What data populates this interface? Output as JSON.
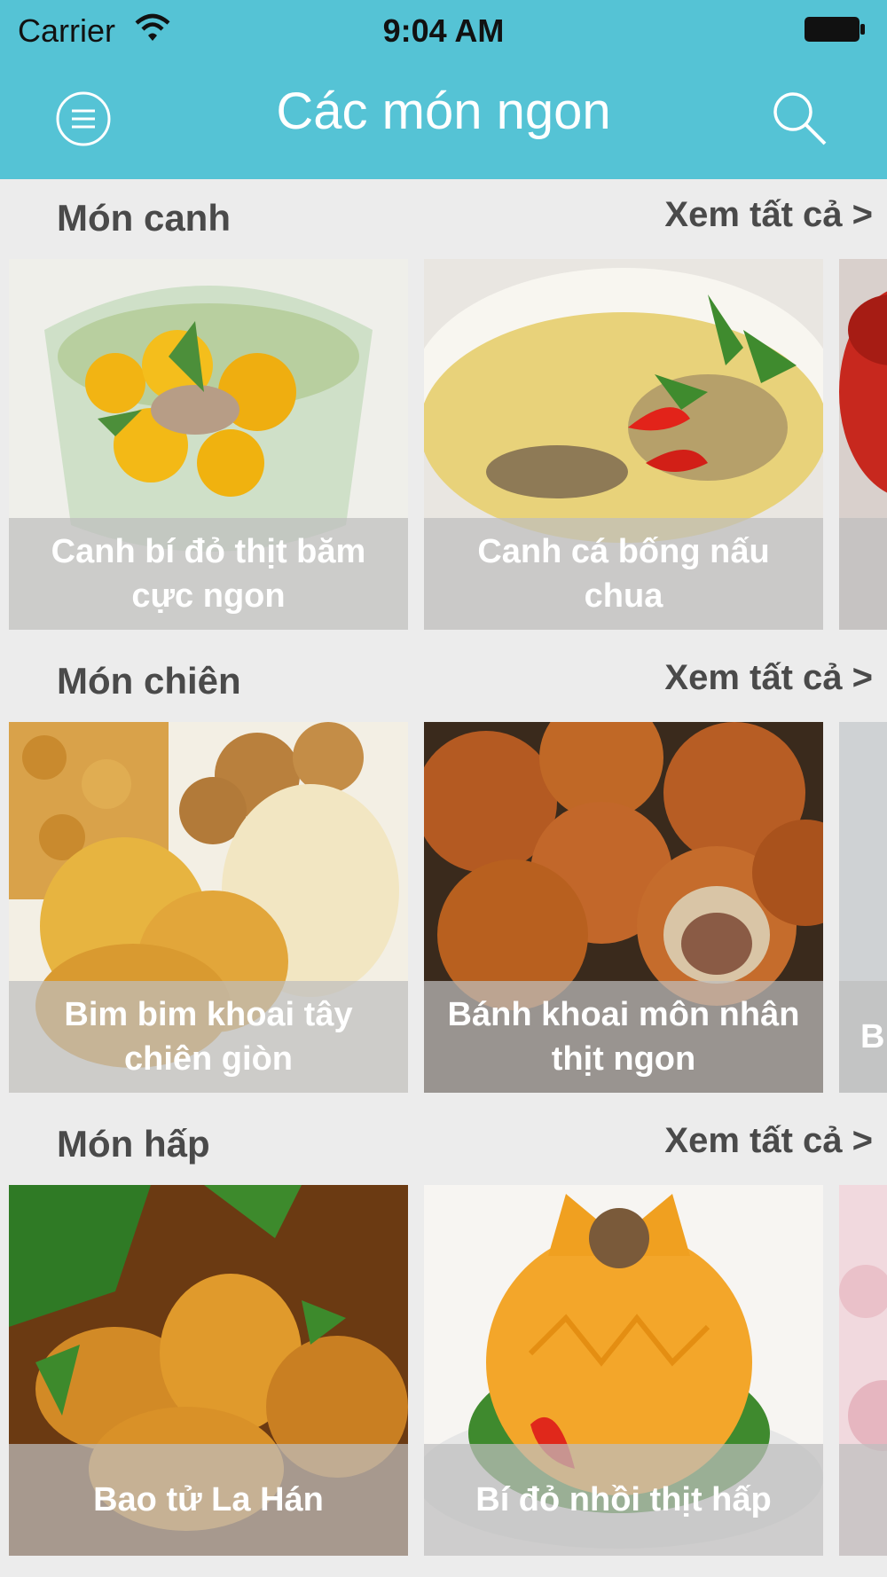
{
  "status_bar": {
    "carrier": "Carrier",
    "time": "9:04 AM"
  },
  "header": {
    "title": "Các món ngon",
    "menu_icon": "menu-icon",
    "search_icon": "search-icon"
  },
  "colors": {
    "header": "#55c3d5",
    "background": "#ececec",
    "section_text": "#4a4a4a"
  },
  "sections": [
    {
      "title": "Món canh",
      "see_all": "Xem tất cả >",
      "items": [
        {
          "name": "Canh bí đỏ thịt băm cực ngon"
        },
        {
          "name": "Canh cá bống nấu chua"
        }
      ]
    },
    {
      "title": "Món chiên",
      "see_all": "Xem tất cả >",
      "items": [
        {
          "name": "Bim bim khoai tây chiên giòn"
        },
        {
          "name": "Bánh khoai môn nhân thịt ngon"
        },
        {
          "name": "B"
        }
      ]
    },
    {
      "title": "Món hấp",
      "see_all": "Xem tất cả >",
      "items": [
        {
          "name": "Bao tử La Hán"
        },
        {
          "name": "Bí đỏ nhồi thịt hấp"
        }
      ]
    }
  ]
}
